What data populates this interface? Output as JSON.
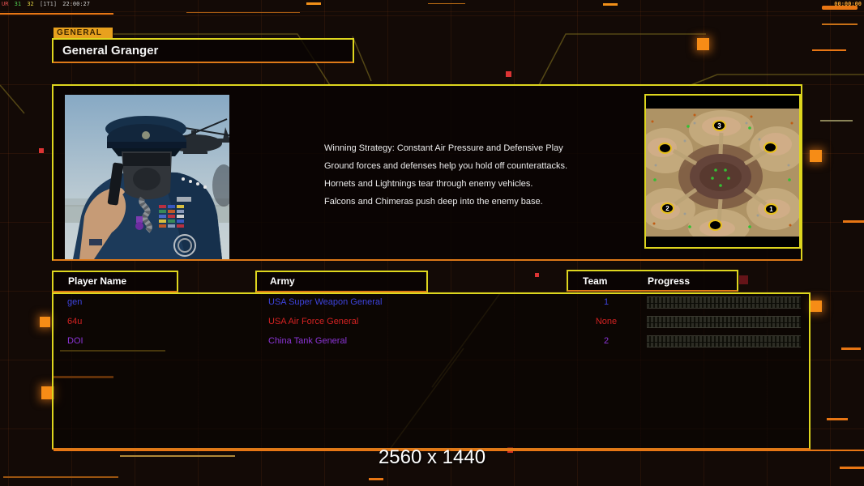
{
  "overlay": {
    "debug": [
      {
        "text": "UR",
        "color": "#e05050"
      },
      {
        "text": "31",
        "color": "#52d052"
      },
      {
        "text": "32",
        "color": "#e0d042"
      },
      {
        "text": "[1T1]",
        "color": "#b6b6b6"
      },
      {
        "text": "22:00:27",
        "color": "#d2d2d2"
      }
    ],
    "timer": "00:00:00"
  },
  "header": {
    "tab_label": "GENERAL",
    "title": "General Granger"
  },
  "briefing": {
    "lines": [
      "Winning Strategy: Constant Air Pressure and Defensive Play",
      "Ground forces and defenses help you hold off counterattacks.",
      "Hornets and Lightnings tear through enemy vehicles.",
      "Falcons and Chimeras push deep into the enemy base."
    ]
  },
  "map": {
    "spawns": [
      {
        "n": "3"
      },
      {
        "n": ""
      },
      {
        "n": ""
      },
      {
        "n": "2"
      },
      {
        "n": "1"
      },
      {
        "n": ""
      }
    ]
  },
  "table": {
    "headers": {
      "player": "Player Name",
      "army": "Army",
      "team": "Team",
      "progress": "Progress"
    },
    "rows": [
      {
        "name": "gen",
        "army": "USA Super Weapon General",
        "team": "1",
        "color": "#3d43dc",
        "progress_percent": 0
      },
      {
        "name": "64u",
        "army": "USA Air Force General",
        "team": "None",
        "color": "#d42222",
        "progress_percent": 0
      },
      {
        "name": "DOI",
        "army": "China Tank General",
        "team": "2",
        "color": "#8c35d8",
        "progress_percent": 0
      }
    ]
  },
  "footer": {
    "resolution": "2560 x 1440"
  },
  "colors": {
    "panel_border": "#ded61e",
    "panel_border_bottom": "#dd7918",
    "accent_orange": "#e87614",
    "tab_background": "#e8a11e",
    "background": "#130a06"
  }
}
